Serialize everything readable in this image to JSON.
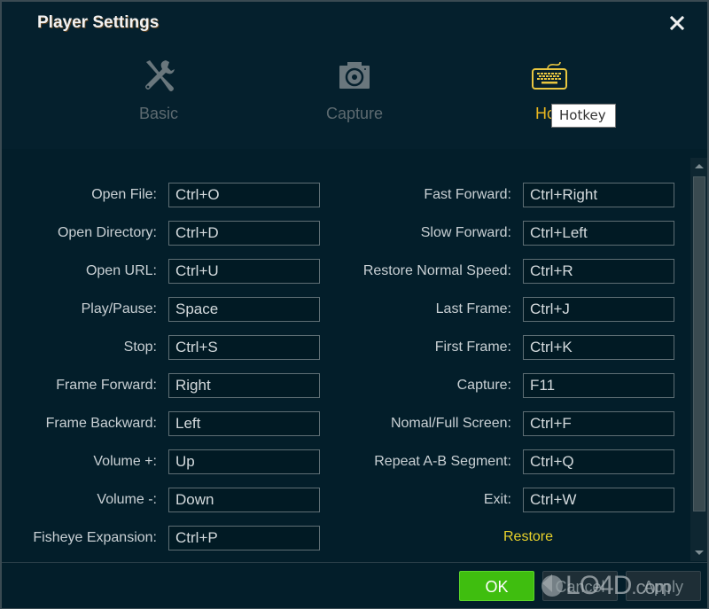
{
  "window": {
    "title": "Player Settings",
    "close_icon": "close-icon"
  },
  "tabs": [
    {
      "label": "Basic",
      "icon": "tools-icon",
      "active": false
    },
    {
      "label": "Capture",
      "icon": "camera-icon",
      "active": false
    },
    {
      "label": "Hotkey",
      "icon": "keyboard-icon",
      "active": true,
      "visible_label": "Hotl"
    }
  ],
  "tooltip": {
    "text": "Hotkey"
  },
  "colors": {
    "background": "#031e2a",
    "active_tab": "#e8b520",
    "inactive_tab": "#5d6a70",
    "restore_link": "#e8d12a",
    "ok_button": "#3fbe0f"
  },
  "hotkeys": {
    "left": [
      {
        "label": "Open File:",
        "value": "Ctrl+O"
      },
      {
        "label": "Open Directory:",
        "value": "Ctrl+D"
      },
      {
        "label": "Open URL:",
        "value": "Ctrl+U"
      },
      {
        "label": "Play/Pause:",
        "value": "Space"
      },
      {
        "label": "Stop:",
        "value": "Ctrl+S"
      },
      {
        "label": "Frame Forward:",
        "value": "Right"
      },
      {
        "label": "Frame Backward:",
        "value": "Left"
      },
      {
        "label": "Volume +:",
        "value": "Up"
      },
      {
        "label": "Volume -:",
        "value": "Down"
      },
      {
        "label": "Fisheye Expansion:",
        "value": "Ctrl+P"
      }
    ],
    "right": [
      {
        "label": "Fast Forward:",
        "value": "Ctrl+Right"
      },
      {
        "label": "Slow Forward:",
        "value": "Ctrl+Left"
      },
      {
        "label": "Restore Normal Speed:",
        "value": "Ctrl+R"
      },
      {
        "label": "Last Frame:",
        "value": "Ctrl+J"
      },
      {
        "label": "First Frame:",
        "value": "Ctrl+K"
      },
      {
        "label": "Capture:",
        "value": "F11"
      },
      {
        "label": "Nomal/Full Screen:",
        "value": "Ctrl+F"
      },
      {
        "label": "Repeat A-B Segment:",
        "value": "Ctrl+Q"
      },
      {
        "label": "Exit:",
        "value": "Ctrl+W"
      }
    ]
  },
  "restore_label": "Restore",
  "footer": {
    "ok_label": "OK",
    "cancel_label": "Cancel",
    "apply_label": "Apply"
  },
  "watermark": {
    "text": "LO4D",
    "suffix": ".com"
  }
}
